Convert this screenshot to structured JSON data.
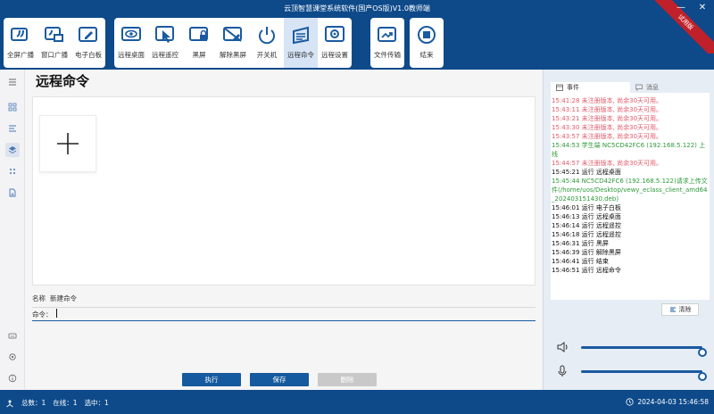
{
  "window": {
    "title": "云顶智慧课堂系统软件(国产OS版)V1.0教师端",
    "ribbon": "试用版",
    "minimize": "—",
    "close": "✕"
  },
  "toolbar": {
    "broadcast": [
      "全屏广播",
      "窗口广播",
      "电子白板"
    ],
    "control": [
      "远程桌面",
      "远程遥控",
      "黑屏",
      "解除黑屏",
      "开关机",
      "远程命令",
      "远程设置"
    ],
    "files": [
      "文件传输"
    ],
    "end": [
      "结束"
    ]
  },
  "main": {
    "title": "远程命令",
    "name_label": "名称",
    "name_value": "新建命令",
    "cmd_label": "命令：",
    "buttons": {
      "execute": "执行",
      "save": "保存",
      "delete": "删除"
    }
  },
  "right": {
    "tab_events": "事件",
    "tab_messages": "消息",
    "log": [
      {
        "text": "15:41:28 未注册版本, 尚余30天可用。",
        "color": "#e05a6a"
      },
      {
        "text": "15:43:11 未注册版本, 尚余30天可用。",
        "color": "#e05a6a"
      },
      {
        "text": "15:43:21 未注册版本, 尚余30天可用。",
        "color": "#e05a6a"
      },
      {
        "text": "15:43:30 未注册版本, 尚余30天可用。",
        "color": "#e05a6a"
      },
      {
        "text": "15:43:57 未注册版本, 尚余30天可用。",
        "color": "#e05a6a"
      },
      {
        "text": "15:44:53 学生端 NC5CD42FC6 (192.168.5.122) 上线",
        "color": "#2e9a3a"
      },
      {
        "text": "15:44:57 未注册版本, 尚余30天可用。",
        "color": "#e05a6a"
      },
      {
        "text": "15:45:21 运行 远程桌面",
        "color": "#111111"
      },
      {
        "text": "15:45:44 NC5CD42FC6 (192.168.5.122)请求上传文件(/home/uos/Desktop/vewy_eclass_client_amd64_202403151430.deb)",
        "color": "#2e9a3a"
      },
      {
        "text": "15:46:01 运行 电子白板",
        "color": "#111111"
      },
      {
        "text": "15:46:13 运行 远程桌面",
        "color": "#111111"
      },
      {
        "text": "15:46:14 运行 远程遥控",
        "color": "#111111"
      },
      {
        "text": "15:46:18 运行 远程遥控",
        "color": "#111111"
      },
      {
        "text": "15:46:31 运行 黑屏",
        "color": "#111111"
      },
      {
        "text": "15:46:39 运行 解除黑屏",
        "color": "#111111"
      },
      {
        "text": "15:46:41 运行 结束",
        "color": "#111111"
      },
      {
        "text": "15:46:51 运行 远程命令",
        "color": "#111111"
      }
    ],
    "clear_label": "清除",
    "speaker_level": 1.0,
    "mic_level": 1.0
  },
  "status": {
    "total": "总数：1",
    "online": "在线：1",
    "selected": "选中：1",
    "datetime": "2024-04-03 15:46:58"
  },
  "colors": {
    "brand": "#0e4a8a",
    "button": "#155a9e",
    "warn_text": "#e05a6a",
    "ok_text": "#2e9a3a"
  }
}
